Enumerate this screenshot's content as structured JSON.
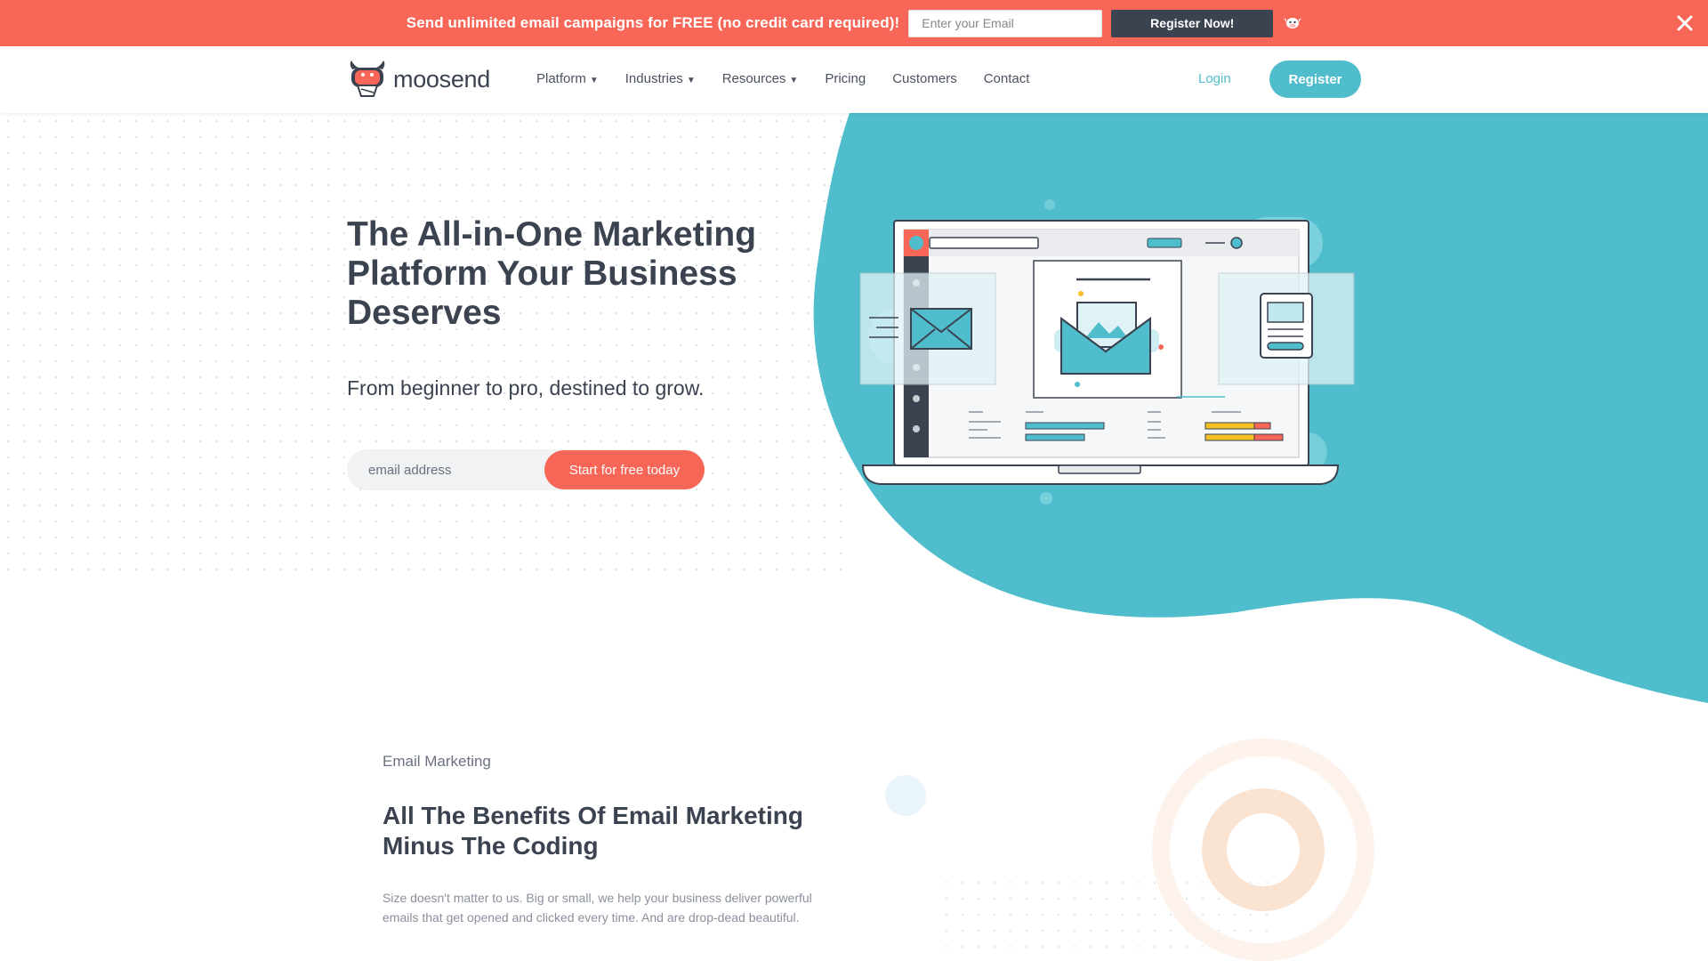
{
  "promo": {
    "text": "Send unlimited email campaigns for FREE (no credit card required)!",
    "email_placeholder": "Enter your Email",
    "button_label": "Register Now!"
  },
  "header": {
    "logo_text": "moosend",
    "nav": [
      {
        "label": "Platform",
        "dropdown": true
      },
      {
        "label": "Industries",
        "dropdown": true
      },
      {
        "label": "Resources",
        "dropdown": true
      },
      {
        "label": "Pricing",
        "dropdown": false
      },
      {
        "label": "Customers",
        "dropdown": false
      },
      {
        "label": "Contact",
        "dropdown": false
      }
    ],
    "caret": "▼",
    "login_label": "Login",
    "register_label": "Register"
  },
  "hero": {
    "title": "The All-in-One Marketing Platform Your Business Deserves",
    "subtitle": "From beginner to pro, destined to grow.",
    "email_placeholder": "email address",
    "cta_label": "Start for free today"
  },
  "benefits": {
    "label": "Email Marketing",
    "title": "All The Benefits Of Email Marketing Minus The Coding",
    "body": "Size doesn't matter to us. Big or small, we help your business deliver powerful emails that get opened and clicked every time. And are drop-dead beautiful."
  },
  "colors": {
    "promo_bg": "#f76656",
    "accent_teal": "#4fbdcc",
    "dark": "#3b4250",
    "cta_coral": "#f76656"
  },
  "icons": [
    "cow-icon",
    "close-icon",
    "moosend-logo-icon",
    "laptop-illustration"
  ]
}
